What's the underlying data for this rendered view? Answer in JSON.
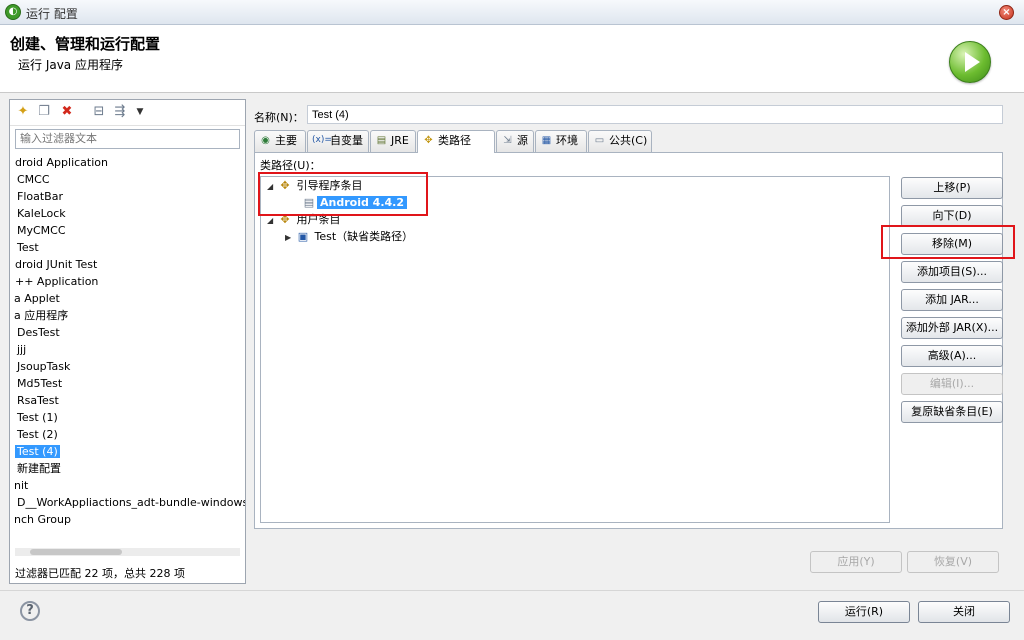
{
  "window": {
    "title": "运行 配置",
    "app_icon": "eclipse-icon"
  },
  "header": {
    "title": "创建、管理和运行配置",
    "subtitle": "运行 Java 应用程序"
  },
  "left": {
    "filter_placeholder": "输入过滤器文本",
    "items": [
      "droid Application",
      "CMCC",
      "FloatBar",
      "KaleLock",
      "MyCMCC",
      "Test",
      "droid JUnit Test",
      "++ Application",
      "a Applet",
      "a 应用程序",
      "DesTest",
      "jjj",
      "JsoupTask",
      "Md5Test",
      "RsaTest",
      "Test (1)",
      "Test (2)",
      "Test (4)",
      "新建配置",
      "nit",
      "D__WorkAppliactions_adt-bundle-windows",
      "nch Group"
    ],
    "selected_index": 17,
    "status": "过滤器已匹配 22 项，总共 228 项"
  },
  "right": {
    "name_label": "名称(N)：",
    "name_value": "Test (4)",
    "tabs": [
      {
        "label": "主要",
        "icon": "main-icon"
      },
      {
        "label": "自变量",
        "icon": "arguments-icon"
      },
      {
        "label": "JRE",
        "icon": "jre-icon"
      },
      {
        "label": "类路径",
        "icon": "classpath-icon"
      },
      {
        "label": "源",
        "icon": "source-icon"
      },
      {
        "label": "环境",
        "icon": "environment-icon"
      },
      {
        "label": "公共(C)",
        "icon": "common-icon"
      }
    ],
    "active_tab": 3,
    "classpath_label": "类路径(U)：",
    "tree": {
      "bootstrap": "引导程序条目",
      "android": "Android 4.4.2",
      "user": "用户条目",
      "test": "Test（缺省类路径）"
    },
    "buttons": {
      "up": "上移(P)",
      "down": "向下(D)",
      "remove": "移除(M)",
      "add_projects": "添加项目(S)...",
      "add_jars": "添加 JAR...",
      "add_external_jars": "添加外部 JAR(X)...",
      "advanced": "高级(A)...",
      "edit": "编辑(I)...",
      "restore_default": "复原缺省条目(E)"
    },
    "apply": "应用(Y)",
    "revert": "恢复(V)"
  },
  "footer": {
    "run": "运行(R)",
    "close": "关闭"
  }
}
